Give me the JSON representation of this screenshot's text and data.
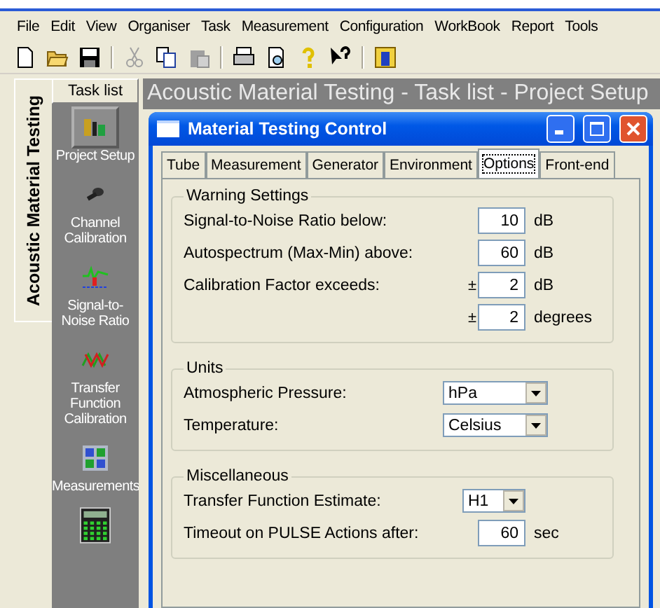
{
  "menu": [
    "File",
    "Edit",
    "View",
    "Organiser",
    "Task",
    "Measurement",
    "Configuration",
    "WorkBook",
    "Report",
    "Tools"
  ],
  "side_tab": {
    "label": "Acoustic Material Testing",
    "selected": true
  },
  "task_list": {
    "header": "Task list",
    "items": [
      {
        "label": "Project Setup",
        "selected": true
      },
      {
        "label": "Channel Calibration",
        "selected": false
      },
      {
        "label": "Signal-to-Noise Ratio",
        "selected": false
      },
      {
        "label": "Transfer Function Calibration",
        "selected": false
      },
      {
        "label": "Measurements",
        "selected": false
      },
      {
        "selected": false
      }
    ]
  },
  "main_title": "Acoustic Material Testing - Task list - Project Setup",
  "dialog": {
    "title": "Material Testing Control",
    "tabs": [
      {
        "label": "Tube",
        "selected": false
      },
      {
        "label": "Measurement",
        "selected": false
      },
      {
        "label": "Generator",
        "selected": false
      },
      {
        "label": "Environment",
        "selected": false
      },
      {
        "label": "Options",
        "selected": true
      },
      {
        "label": "Front-end",
        "selected": false
      }
    ],
    "groups": [
      {
        "title": "Warning Settings",
        "rows": [
          {
            "kind": "number",
            "label": "Signal-to-Noise Ratio below:",
            "value": "10",
            "unit": "dB"
          },
          {
            "kind": "number",
            "label": "Autospectrum (Max-Min) above:",
            "value": "60",
            "unit": "dB"
          },
          {
            "kind": "number",
            "label": "Calibration Factor exceeds:",
            "prefix": "±",
            "value": "2",
            "unit": "dB"
          },
          {
            "kind": "number",
            "prefix": "±",
            "value": "2",
            "unit": "degrees"
          }
        ]
      },
      {
        "title": "Units",
        "rows": [
          {
            "kind": "select",
            "label": "Atmospheric Pressure:",
            "value": "hPa"
          },
          {
            "kind": "select",
            "label": "Temperature:",
            "value": "Celsius"
          }
        ]
      },
      {
        "title": "Miscellaneous",
        "rows": [
          {
            "kind": "select-small",
            "label": "Transfer Function Estimate:",
            "value": "H1"
          },
          {
            "kind": "number",
            "label": "Timeout on PULSE Actions after:",
            "value": "60",
            "unit": "sec"
          }
        ]
      }
    ]
  }
}
